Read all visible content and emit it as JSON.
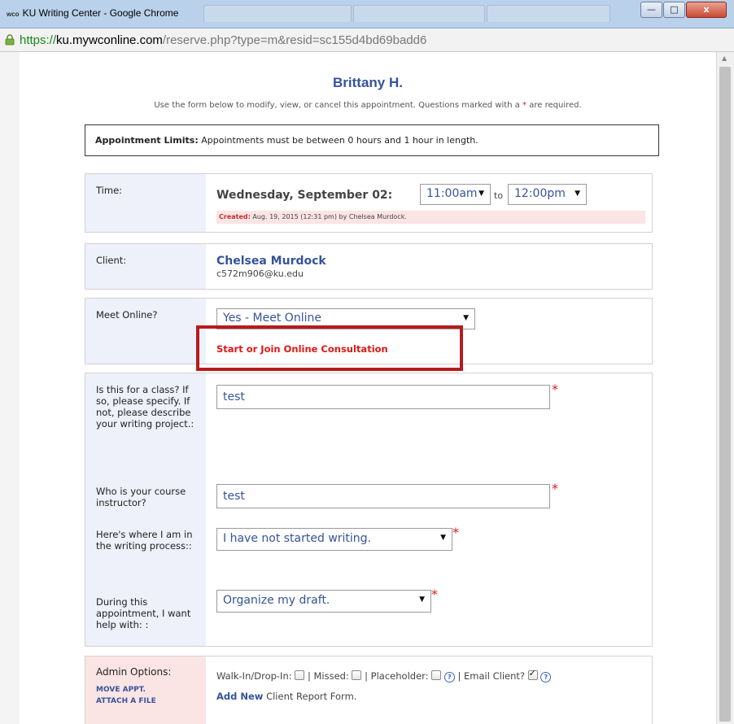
{
  "window": {
    "icon_text": "wco",
    "title": "KU Writing Center - Google Chrome",
    "minimize_glyph": "—",
    "maximize_glyph": "□",
    "close_glyph": "x"
  },
  "address_bar": {
    "scheme": "https://",
    "host": "ku.mywconline.com",
    "path": "/reserve.php?type=m&resid=sc155d4bd69badd6"
  },
  "header": {
    "title": "Brittany H.",
    "instructions_before": "Use the form below to modify, view, or cancel this appointment. Questions marked with a",
    "required_mark": "*",
    "instructions_after": "are required."
  },
  "limits": {
    "label": "Appointment Limits:",
    "text": "Appointments must be between 0 hours and 1 hour in length."
  },
  "time": {
    "label": "Time:",
    "date": "Wednesday, September 02:",
    "start": "11:00am",
    "to": "to",
    "end": "12:00pm",
    "created_label": "Created:",
    "created_text": "Aug. 19, 2015 (12:31 pm) by Chelsea Murdock."
  },
  "client": {
    "label": "Client:",
    "name": "Chelsea Murdock",
    "email": "c572m906@ku.edu"
  },
  "meet_online": {
    "label": "Meet Online?",
    "value": "Yes - Meet Online",
    "link": "Start or Join Online Consultation"
  },
  "questions": {
    "class_label": "Is this for a class? If so, please specify. If not, please describe your writing project.:",
    "class_value": "test",
    "instructor_label": "Who is your course instructor?",
    "instructor_value": "test",
    "process_label": "Here's where I am in the writing process::",
    "process_value": "I have not started writing.",
    "help_label": "During this appointment, I want help with: :",
    "help_value": "Organize my draft.",
    "required_mark": "*"
  },
  "admin": {
    "label": "Admin Options:",
    "move": "MOVE APPT.",
    "attach": "ATTACH A FILE",
    "walk_in": "Walk-In/Drop-In:",
    "missed": "| Missed:",
    "placeholder": "| Placeholder:",
    "email_client": "| Email Client?",
    "email_client_checked": true,
    "add_new": "Add New",
    "report": "Client Report Form.",
    "help_glyph": "?"
  },
  "glyphs": {
    "dropdown_arrow": "▼",
    "scroll_up": "▲"
  },
  "icons": {
    "lock": "lock-icon",
    "dropdown": "dropdown-arrow-icon",
    "help": "help-icon",
    "checkbox": "checkbox-icon"
  },
  "colors": {
    "link_blue": "#35539a",
    "required_red": "#e01818",
    "highlight_border": "#b71c1c",
    "label_bg": "#eef0fa",
    "created_bg": "#fbe4e4"
  }
}
